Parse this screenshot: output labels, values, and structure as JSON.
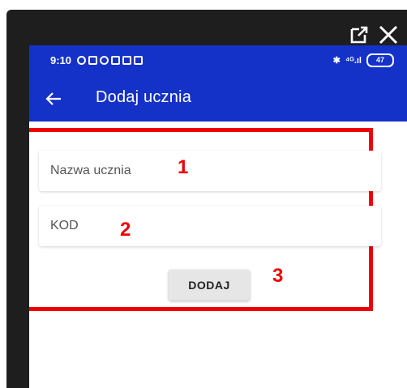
{
  "window_controls": {
    "popout_icon": "external-link-icon",
    "close_icon": "close-icon"
  },
  "statusbar": {
    "time": "9:10",
    "battery": "47",
    "signal": "⁴ᴳ.ıl"
  },
  "appbar": {
    "back_icon": "arrow-left-icon",
    "title": "Dodaj ucznia"
  },
  "form": {
    "student_name_placeholder": "Nazwa ucznia",
    "code_placeholder": "KOD",
    "add_button_label": "DODAJ"
  },
  "annotations": {
    "marker_1": "1",
    "marker_2": "2",
    "marker_3": "3"
  },
  "colors": {
    "app_bar": "#1432c8",
    "highlight": "#ee0000",
    "frame": "#1e1e1e"
  }
}
